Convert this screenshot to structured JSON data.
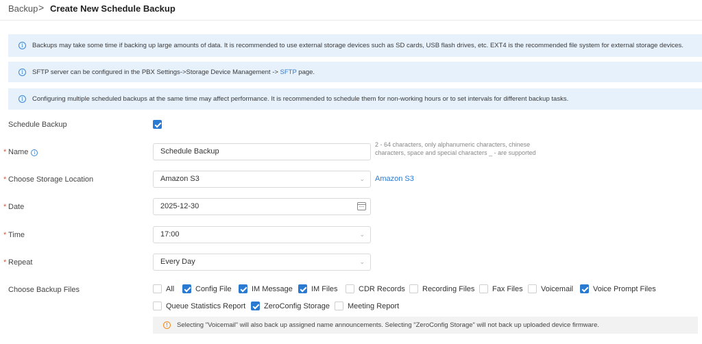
{
  "breadcrumb": {
    "parent": "Backup",
    "separator": ">",
    "current": "Create New Schedule Backup"
  },
  "alerts": [
    {
      "text": "Backups may take some time if backing up large amounts of data. It is recommended to use external storage devices such as SD cards, USB flash drives, etc. EXT4 is the recommended file system for external storage devices."
    },
    {
      "text_before": "SFTP server can be configured in the PBX Settings->Storage Device Management -> ",
      "link": "SFTP",
      "text_after": " page."
    },
    {
      "text": "Configuring multiple scheduled backups at the same time may affect performance. It is recommended to schedule them for non-working hours or to set intervals for different backup tasks."
    }
  ],
  "form": {
    "schedule_backup": {
      "label": "Schedule Backup",
      "checked": true
    },
    "name": {
      "label": "Name",
      "required": true,
      "value": "Schedule Backup",
      "hint": "2 - 64 characters, only alphanumeric characters, chinese characters, space and special characters _ - are supported"
    },
    "storage": {
      "label": "Choose Storage Location",
      "required": true,
      "value": "Amazon S3",
      "link": "Amazon S3"
    },
    "date": {
      "label": "Date",
      "required": true,
      "value": "2025-12-30"
    },
    "time": {
      "label": "Time",
      "required": true,
      "value": "17:00"
    },
    "repeat": {
      "label": "Repeat",
      "required": true,
      "value": "Every Day"
    },
    "backup_files": {
      "label": "Choose Backup Files",
      "options": [
        {
          "label": "All",
          "checked": false
        },
        {
          "label": "Config File",
          "checked": true
        },
        {
          "label": "IM Message",
          "checked": true
        },
        {
          "label": "IM Files",
          "checked": true
        },
        {
          "label": "CDR Records",
          "checked": false
        },
        {
          "label": "Recording Files",
          "checked": false
        },
        {
          "label": "Fax Files",
          "checked": false
        },
        {
          "label": "Voicemail",
          "checked": false
        },
        {
          "label": "Voice Prompt Files",
          "checked": true
        },
        {
          "label": "Queue Statistics Report",
          "checked": false
        },
        {
          "label": "ZeroConfig Storage",
          "checked": true
        },
        {
          "label": "Meeting Report",
          "checked": false
        }
      ]
    },
    "warning": "Selecting \"Voicemail\" will also back up assigned name announcements. Selecting \"ZeroConfig Storage\" will not back up uploaded device firmware."
  },
  "icons": {
    "info": "info-circle-icon",
    "warning": "warning-circle-icon",
    "select": "chevron-down-icon",
    "calendar": "calendar-icon"
  },
  "colors": {
    "accent": "#2a7ad2",
    "alert_bg": "#e6f1fc",
    "required": "#e0533a",
    "warning": "#f08c1c"
  }
}
